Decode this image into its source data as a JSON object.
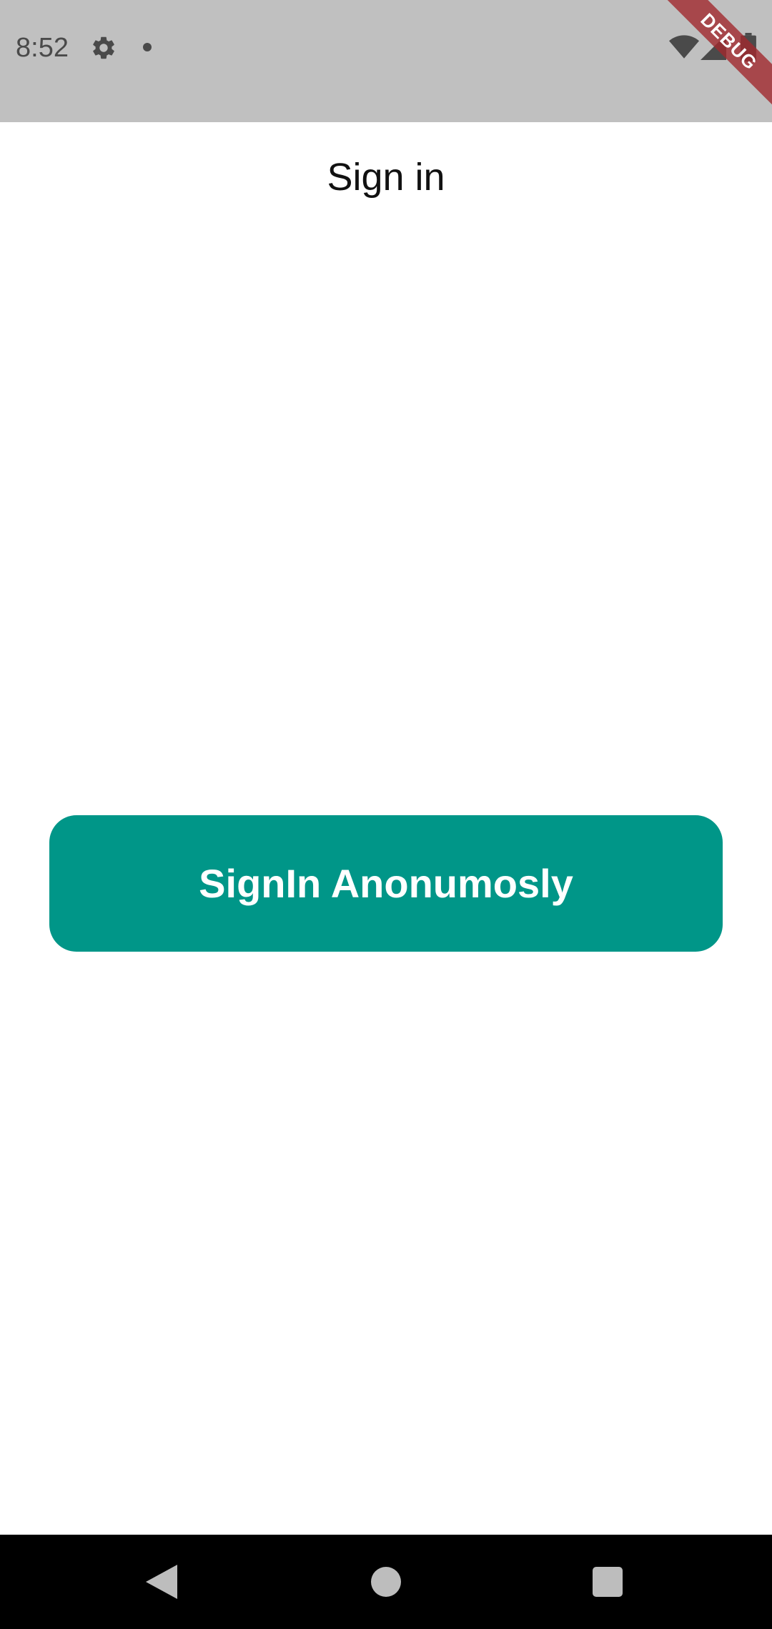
{
  "status_bar": {
    "time": "8:52",
    "icons": [
      "gear-icon",
      "notification-dot-icon",
      "wifi-icon",
      "cell-signal-icon",
      "battery-icon"
    ],
    "background": "#c0c0c0"
  },
  "debug_banner": {
    "label": "DEBUG",
    "color": "#a0282d"
  },
  "app_bar": {
    "title": "Sign in"
  },
  "main": {
    "signin_button_label": "SignIn Anonumosly",
    "accent_color": "#009688"
  },
  "nav_bar": {
    "icons": [
      "back-icon",
      "home-icon",
      "recents-icon"
    ]
  }
}
